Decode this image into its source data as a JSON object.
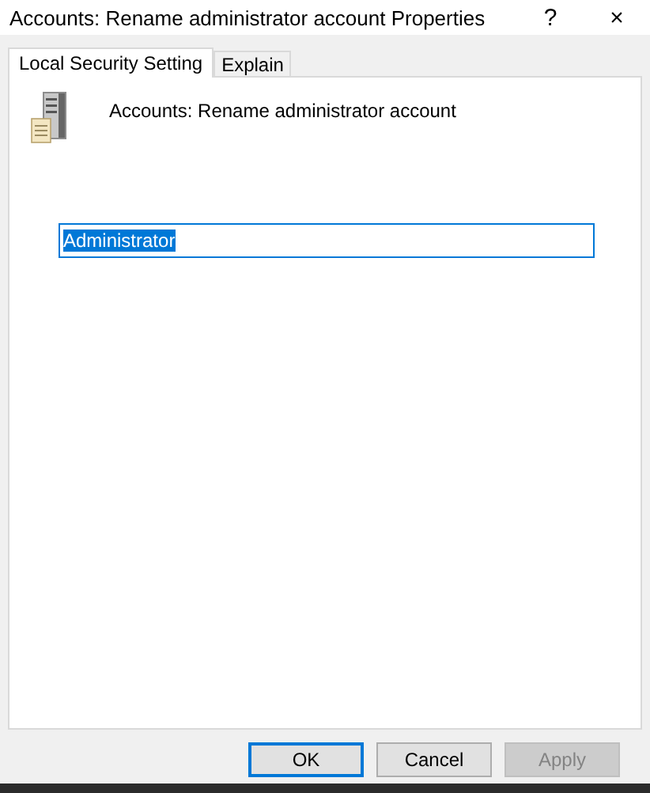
{
  "window": {
    "title": "Accounts: Rename administrator account Properties",
    "help": "?",
    "close": "×"
  },
  "tabs": [
    {
      "label": "Local Security Setting",
      "selected": true
    },
    {
      "label": "Explain",
      "selected": false
    }
  ],
  "policy": {
    "name": "Accounts: Rename administrator account"
  },
  "field": {
    "value": "Administrator",
    "text_selected": true
  },
  "buttons": [
    {
      "label": "OK",
      "default": true,
      "disabled": false
    },
    {
      "label": "Cancel",
      "default": false,
      "disabled": false
    },
    {
      "label": "Apply",
      "default": false,
      "disabled": true
    }
  ]
}
